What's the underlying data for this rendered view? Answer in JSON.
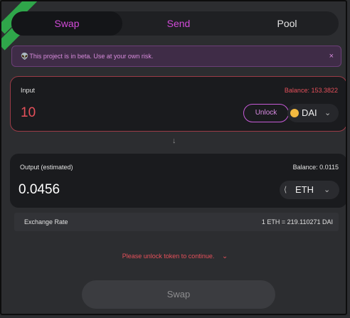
{
  "tabs": [
    {
      "label": "Swap"
    },
    {
      "label": "Send"
    },
    {
      "label": "Pool"
    }
  ],
  "banner": {
    "text": "This project is in beta. Use at your own risk.",
    "close": "×"
  },
  "input": {
    "label": "Input",
    "balance": "Balance: 153.3822",
    "amount": "10",
    "unlock_label": "Unlock",
    "token": "DAI"
  },
  "arrow": "↓",
  "output": {
    "label": "Output (estimated)",
    "balance": "Balance: 0.0115",
    "amount": "0.0456",
    "token": "ETH"
  },
  "exchange": {
    "label": "Exchange Rate",
    "value": "1 ETH = 219.110271 DAI"
  },
  "warning": "Please unlock token to continue.",
  "swap_button": "Swap",
  "colors": {
    "accent": "#d14ad8",
    "error": "#e5505a",
    "background": "#2c2d30"
  }
}
